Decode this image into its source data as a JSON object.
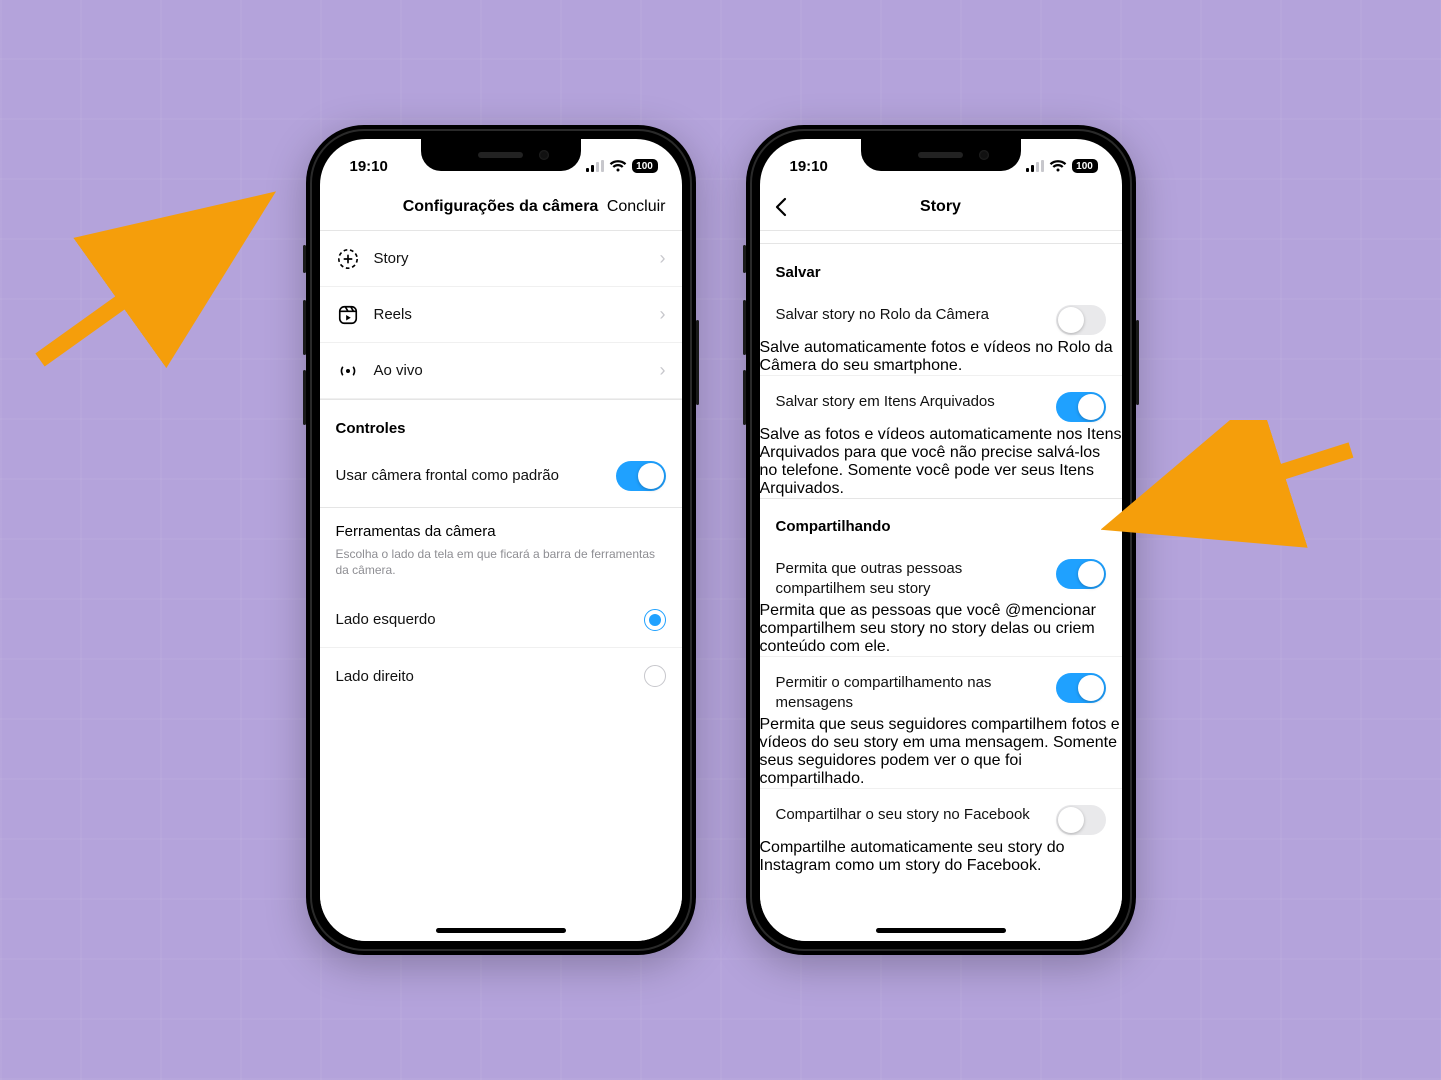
{
  "status": {
    "time": "19:10",
    "battery": "100"
  },
  "screen1": {
    "nav_title": "Configurações da câmera",
    "done": "Concluir",
    "items": {
      "story": "Story",
      "reels": "Reels",
      "live": "Ao vivo"
    },
    "controls_header": "Controles",
    "front_camera": "Usar câmera frontal como padrão",
    "tools_title": "Ferramentas da câmera",
    "tools_desc": "Escolha o lado da tela em que ficará a barra de ferramentas da câmera.",
    "left_side": "Lado esquerdo",
    "right_side": "Lado direito"
  },
  "screen2": {
    "nav_title": "Story",
    "save_header": "Salvar",
    "save_roll_t": "Salvar story no Rolo da Câmera",
    "save_roll_d": "Salve automaticamente fotos e vídeos no Rolo da Câmera do seu smartphone.",
    "save_arch_t": "Salvar story em Itens Arquivados",
    "save_arch_d": "Salve as fotos e vídeos automaticamente nos Itens Arquivados para que você não precise salvá-los no telefone. Somente você pode ver seus Itens Arquivados.",
    "share_header": "Compartilhando",
    "share_allow_t": "Permita que outras pessoas compartilhem seu story",
    "share_allow_d": "Permita que as pessoas que você @mencionar compartilhem seu story no story delas ou criem conteúdo com ele.",
    "share_msg_t": "Permitir o compartilhamento nas mensagens",
    "share_msg_d": "Permita que seus seguidores compartilhem fotos e vídeos do seu story em uma mensagem. Somente seus seguidores podem ver o que foi compartilhado.",
    "share_fb_t": "Compartilhar o seu story no Facebook",
    "share_fb_d": "Compartilhe automaticamente seu story do Instagram como um story do Facebook."
  },
  "toggles": {
    "front_camera": true,
    "save_roll": false,
    "save_arch": true,
    "share_allow": true,
    "share_msg": true,
    "share_fb": false
  },
  "radio_selected": "left"
}
